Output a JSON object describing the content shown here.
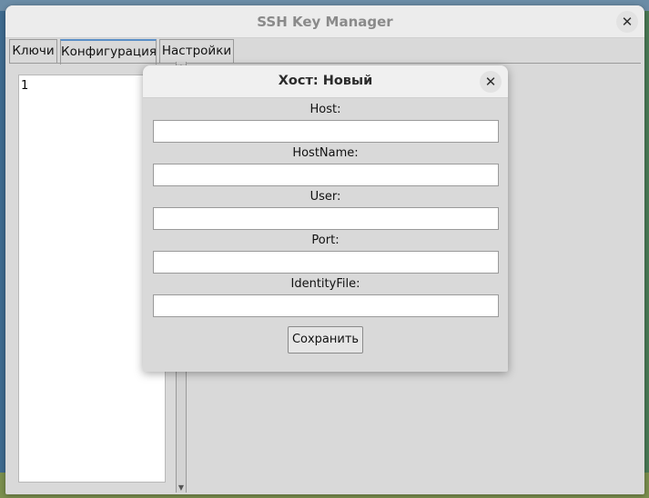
{
  "window": {
    "title": "SSH Key Manager",
    "close_glyph": "✕"
  },
  "tabs": [
    {
      "label": "Ключи"
    },
    {
      "label": "Конфигурация",
      "active": true
    },
    {
      "label": "Настройки"
    }
  ],
  "hosts_list": {
    "items": [
      "1"
    ]
  },
  "scrollbar": {
    "up_glyph": "▲",
    "down_glyph": "▼"
  },
  "dialog": {
    "title": "Хост: Новый",
    "close_glyph": "✕",
    "fields": [
      {
        "label": "Host:",
        "value": ""
      },
      {
        "label": "HostName:",
        "value": ""
      },
      {
        "label": "User:",
        "value": ""
      },
      {
        "label": "Port:",
        "value": ""
      },
      {
        "label": "IdentityFile:",
        "value": ""
      }
    ],
    "save_label": "Сохранить"
  },
  "colors": {
    "window_bg": "#d9d9d9",
    "tab_accent": "#5b8fc7",
    "title_inactive": "#8a8a8a"
  }
}
